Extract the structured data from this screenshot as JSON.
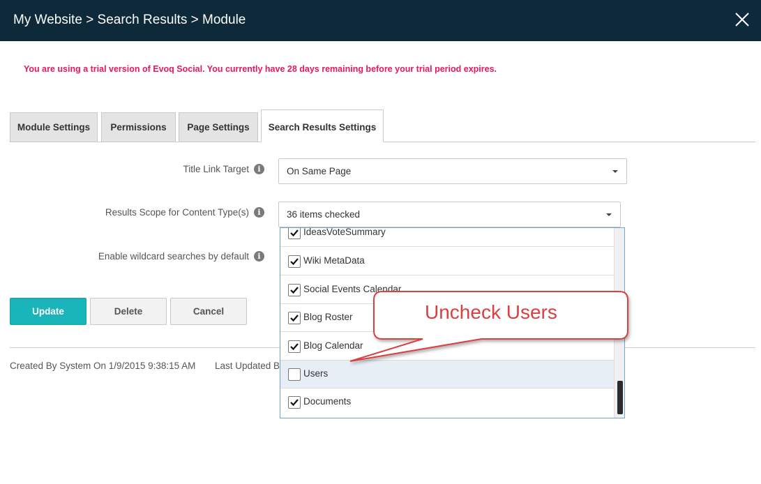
{
  "window": {
    "title": "My Website > Search Results > Module",
    "close_icon": "close-icon"
  },
  "trial_message": "You are using a trial version of Evoq Social. You currently have 28 days remaining before your trial period expires.",
  "tabs": [
    {
      "label": "Module Settings",
      "active": false
    },
    {
      "label": "Permissions",
      "active": false
    },
    {
      "label": "Page Settings",
      "active": false
    },
    {
      "label": "Search Results Settings",
      "active": true
    }
  ],
  "form": {
    "title_link_target": {
      "label": "Title Link Target",
      "value": "On Same Page"
    },
    "results_scope": {
      "label": "Results Scope for Content Type(s)",
      "value": "36 items checked"
    },
    "wildcard": {
      "label": "Enable wildcard searches by default"
    }
  },
  "buttons": {
    "update": "Update",
    "delete": "Delete",
    "cancel": "Cancel"
  },
  "footer": {
    "created": "Created By System On 1/9/2015 9:38:15 AM",
    "last_updated": "Last Updated B"
  },
  "dropdown_items": [
    {
      "label": "IdeasVoteSummary",
      "checked": true
    },
    {
      "label": "Wiki MetaData",
      "checked": true
    },
    {
      "label": "Social Events Calendar",
      "checked": true
    },
    {
      "label": "Blog Roster",
      "checked": true
    },
    {
      "label": "Blog Calendar",
      "checked": true
    },
    {
      "label": "Users",
      "checked": false
    },
    {
      "label": "Documents",
      "checked": true
    }
  ],
  "callout": {
    "text": "Uncheck Users"
  },
  "colors": {
    "titlebar": "#0e2a3a",
    "trial_text": "#e8175d",
    "primary_button": "#1ab4bb",
    "callout_border": "#d94040"
  }
}
